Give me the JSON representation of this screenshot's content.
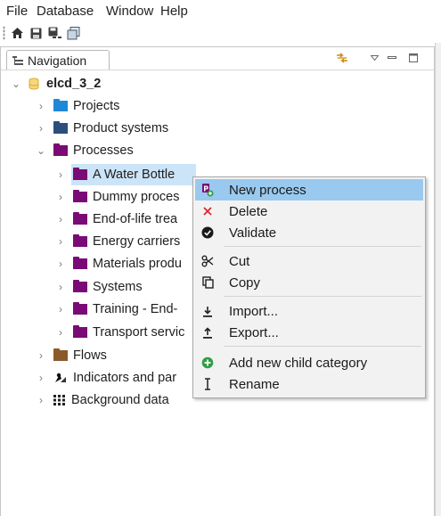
{
  "menubar": {
    "items": [
      "File",
      "Database",
      "Window",
      "Help"
    ]
  },
  "toolbar": {
    "buttons": [
      "home-icon",
      "save-icon",
      "save-all-icon",
      "pages-icon"
    ]
  },
  "navigation": {
    "tab_label": "Navigation",
    "tree": {
      "root": "elcd_3_2",
      "items": [
        {
          "label": "Projects",
          "level": 1,
          "expanded": false,
          "icon": "folder-blue"
        },
        {
          "label": "Product systems",
          "level": 1,
          "expanded": false,
          "icon": "folder-dark-blue"
        },
        {
          "label": "Processes",
          "level": 1,
          "expanded": true,
          "icon": "folder-purple"
        },
        {
          "label": "A Water Bottle",
          "level": 2,
          "expanded": false,
          "icon": "folder-purple",
          "selected": true
        },
        {
          "label": "Dummy proces",
          "level": 2,
          "expanded": false,
          "icon": "folder-purple"
        },
        {
          "label": "End-of-life trea",
          "level": 2,
          "expanded": false,
          "icon": "folder-purple"
        },
        {
          "label": "Energy carriers",
          "level": 2,
          "expanded": false,
          "icon": "folder-purple"
        },
        {
          "label": "Materials produ",
          "level": 2,
          "expanded": false,
          "icon": "folder-purple"
        },
        {
          "label": "Systems",
          "level": 2,
          "expanded": false,
          "icon": "folder-purple"
        },
        {
          "label": "Training - End-",
          "level": 2,
          "expanded": false,
          "icon": "folder-purple"
        },
        {
          "label": "Transport servic",
          "level": 2,
          "expanded": false,
          "icon": "folder-purple"
        },
        {
          "label": "Flows",
          "level": 1,
          "expanded": false,
          "icon": "folder-brown"
        },
        {
          "label": "Indicators and par",
          "level": 1,
          "expanded": false,
          "icon": "indicators-icon"
        },
        {
          "label": "Background data",
          "level": 1,
          "expanded": false,
          "icon": "grid-icon"
        }
      ]
    }
  },
  "context_menu": {
    "items": [
      {
        "label": "New process",
        "icon": "new-process-icon",
        "highlighted": true
      },
      {
        "label": "Delete",
        "icon": "delete-icon"
      },
      {
        "label": "Validate",
        "icon": "validate-icon"
      },
      {
        "label": "Cut",
        "icon": "cut-icon"
      },
      {
        "label": "Copy",
        "icon": "copy-icon"
      },
      {
        "label": "Import...",
        "icon": "import-icon"
      },
      {
        "label": "Export...",
        "icon": "export-icon"
      },
      {
        "label": "Add new child category",
        "icon": "add-child-icon"
      },
      {
        "label": "Rename",
        "icon": "rename-icon"
      }
    ]
  },
  "colors": {
    "selection": "#cce4f7",
    "menu_highlight": "#99c9ef",
    "process_folder": "#7a0a75",
    "project_folder": "#1e88d6",
    "flow_folder": "#8b5a2b",
    "database_icon": "#f2c94c"
  }
}
